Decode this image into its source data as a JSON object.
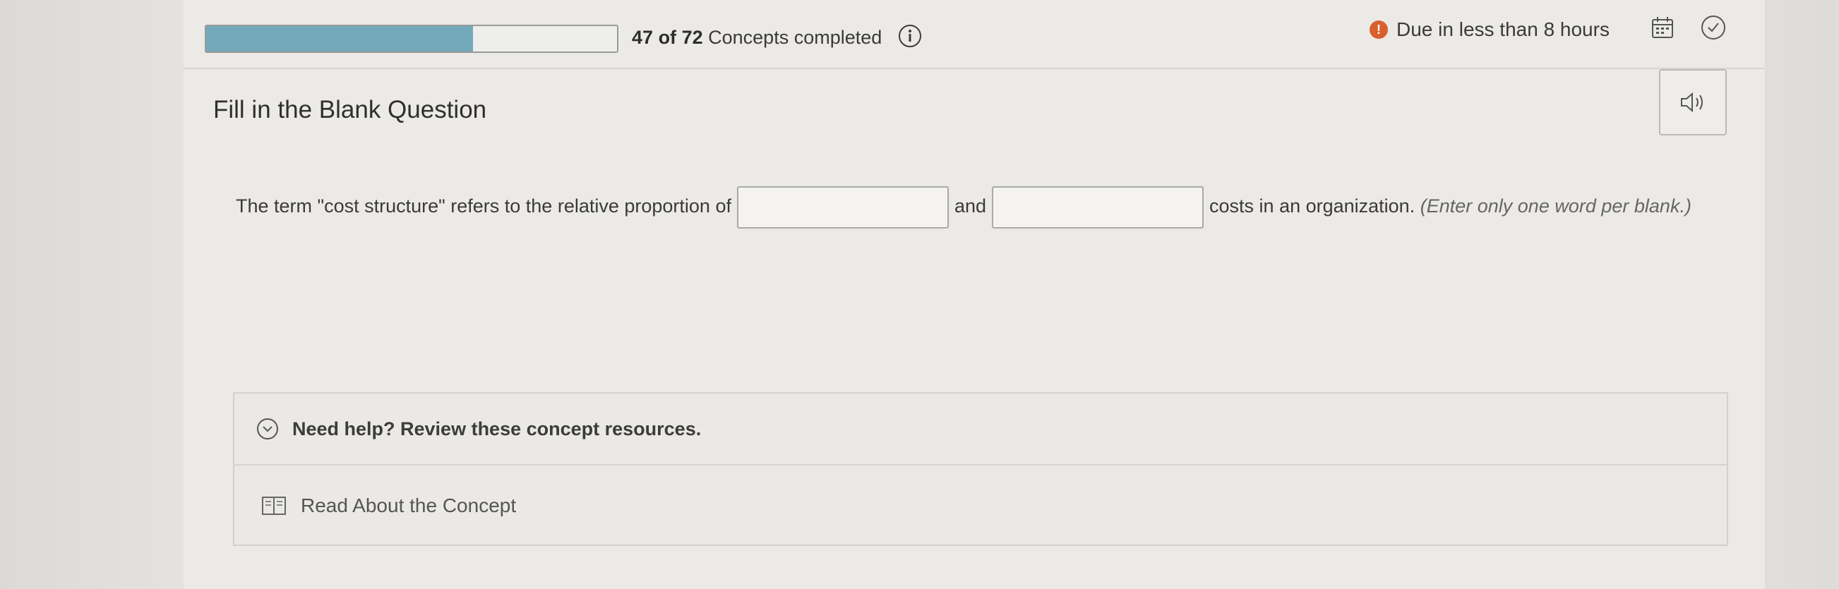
{
  "progress": {
    "completed": "47",
    "total": "72",
    "of_word": "of",
    "label": "Concepts completed",
    "fraction": 0.65
  },
  "due": {
    "text": "Due in less than 8 hours",
    "alert_glyph": "!"
  },
  "question": {
    "title": "Fill in the Blank Question",
    "text_before": "The term \"cost structure\" refers to the relative proportion of",
    "text_between": "and",
    "text_after": "costs in an organization.",
    "instruction": "(Enter only one word per blank.)",
    "blank1_value": "",
    "blank2_value": ""
  },
  "help": {
    "label": "Need help? Review these concept resources.",
    "read_label": "Read About the Concept"
  },
  "icons": {
    "info": "info-icon",
    "alert": "alert-icon",
    "calendar": "calendar-icon",
    "check": "check-circle-icon",
    "speaker": "speaker-icon",
    "chevron": "chevron-down-icon",
    "book": "book-icon"
  },
  "colors": {
    "progress_fill": "#74a9bb",
    "due_alert": "#d9602c"
  }
}
